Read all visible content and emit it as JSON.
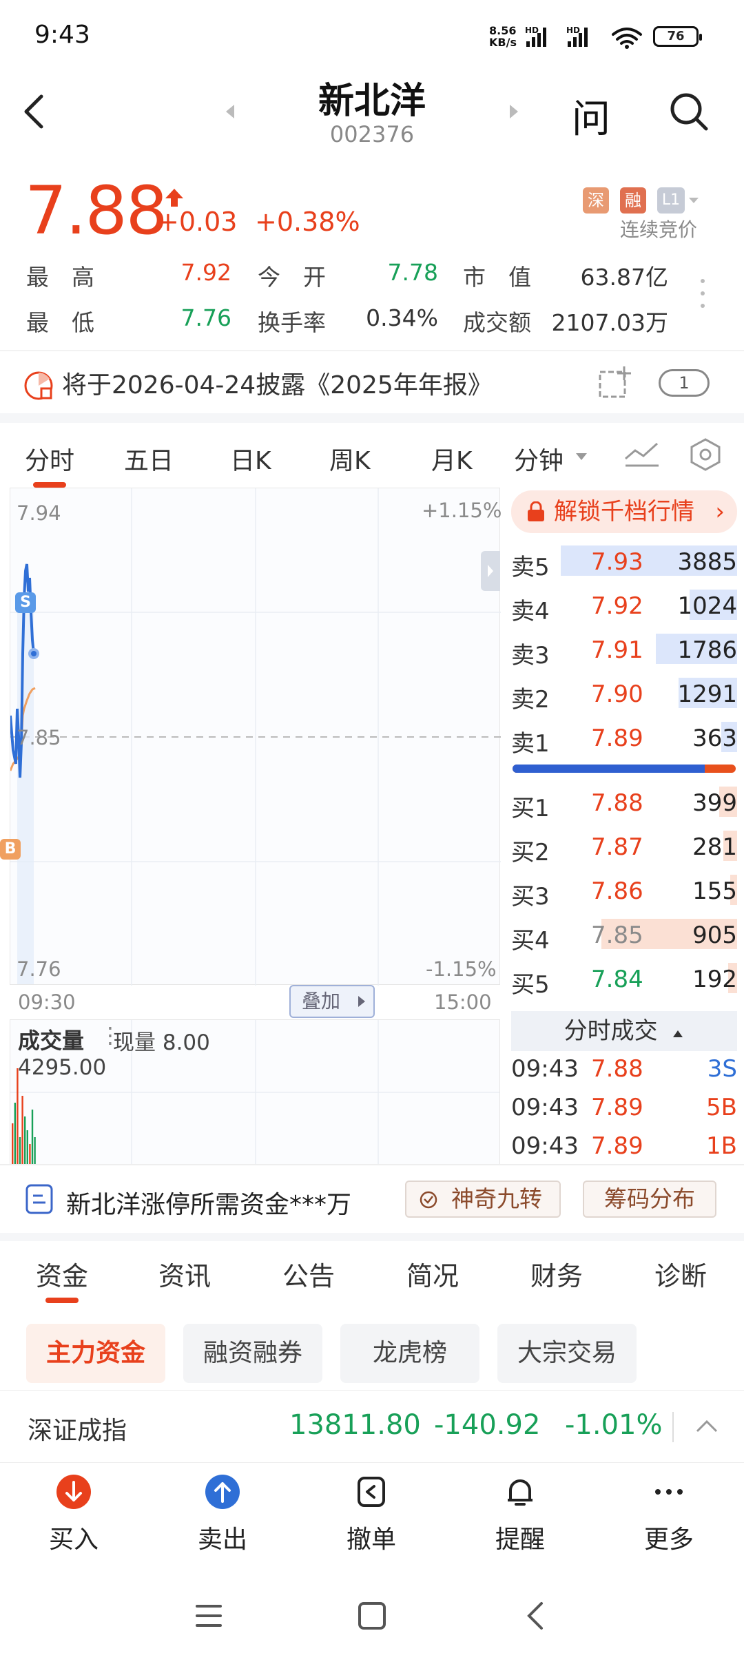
{
  "status_bar": {
    "time": "9:43",
    "net_speed": "8.56",
    "net_unit": "KB/s",
    "battery": "76"
  },
  "header": {
    "title": "新北洋",
    "code": "002376",
    "ask_label": "问"
  },
  "quote": {
    "price": "7.88",
    "change": "+0.03",
    "change_pct": "+0.38%",
    "tags": [
      "深",
      "融",
      "L1"
    ],
    "trade_status": "连续竞价",
    "stats": [
      {
        "label": "最　高",
        "value": "7.92",
        "color": "red"
      },
      {
        "label": "今　开",
        "value": "7.78",
        "color": "green"
      },
      {
        "label": "市　值",
        "value": "63.87亿",
        "color": "dark"
      },
      {
        "label": "最　低",
        "value": "7.76",
        "color": "green"
      },
      {
        "label": "换手率",
        "value": "0.34%",
        "color": "dark"
      },
      {
        "label": "成交额",
        "value": "2107.03万",
        "color": "dark"
      }
    ]
  },
  "notice": {
    "text": "将于2026-04-24披露《2025年年报》",
    "badge": "1"
  },
  "chart_tabs": [
    "分时",
    "五日",
    "日K",
    "周K",
    "月K",
    "分钟"
  ],
  "chart": {
    "y_top": "7.94",
    "y_mid": "7.85",
    "y_bottom": "7.76",
    "pct_top": "+1.15%",
    "pct_bottom": "-1.15%",
    "x_start": "09:30",
    "x_end": "15:00",
    "overlay_label": "叠加",
    "marker_s": "S",
    "marker_b": "B",
    "colors": {
      "price_line": "#2f6fd6",
      "avg_line": "#f0a060",
      "up": "#e8401c",
      "down": "#18a058"
    }
  },
  "volume": {
    "title": "成交量",
    "current_label": "现量 8.00",
    "max_value": "4295.00"
  },
  "order_book": {
    "unlock_label": "解锁千档行情",
    "asks": [
      {
        "label": "卖5",
        "price": "7.93",
        "volume": "3885",
        "color": "red",
        "depth": 0.78
      },
      {
        "label": "卖4",
        "price": "7.92",
        "volume": "1024",
        "color": "red",
        "depth": 0.21
      },
      {
        "label": "卖3",
        "price": "7.91",
        "volume": "1786",
        "color": "red",
        "depth": 0.36
      },
      {
        "label": "卖2",
        "price": "7.90",
        "volume": "1291",
        "color": "red",
        "depth": 0.26
      },
      {
        "label": "卖1",
        "price": "7.89",
        "volume": "363",
        "color": "red",
        "depth": 0.07
      }
    ],
    "bids": [
      {
        "label": "买1",
        "price": "7.88",
        "volume": "399",
        "color": "red",
        "depth": 0.08
      },
      {
        "label": "买2",
        "price": "7.87",
        "volume": "281",
        "color": "red",
        "depth": 0.06
      },
      {
        "label": "买3",
        "price": "7.86",
        "volume": "155",
        "color": "red",
        "depth": 0.03
      },
      {
        "label": "买4",
        "price": "7.85",
        "volume": "905",
        "color": "gray",
        "depth": 0.6
      },
      {
        "label": "买5",
        "price": "7.84",
        "volume": "192",
        "color": "green",
        "depth": 0.04
      }
    ],
    "ask_bid_ratio": 0.86
  },
  "ticks": {
    "header": "分时成交",
    "rows": [
      {
        "time": "09:43",
        "price": "7.88",
        "vol": "3S",
        "vol_color": "blue"
      },
      {
        "time": "09:43",
        "price": "7.89",
        "vol": "5B",
        "vol_color": "red"
      },
      {
        "time": "09:43",
        "price": "7.89",
        "vol": "1B",
        "vol_color": "red"
      }
    ]
  },
  "promo": {
    "text": "新北洋涨停所需资金***万",
    "pill1": "神奇九转",
    "pill2": "筹码分布"
  },
  "info_tabs": [
    "资金",
    "资讯",
    "公告",
    "简况",
    "财务",
    "诊断"
  ],
  "sub_tabs": [
    "主力资金",
    "融资融券",
    "龙虎榜",
    "大宗交易"
  ],
  "index": {
    "name": "深证成指",
    "value": "13811.80",
    "change": "-140.92",
    "change_pct": "-1.01%"
  },
  "bottom_nav": [
    {
      "label": "买入",
      "icon": "buy-arrow-down-icon"
    },
    {
      "label": "卖出",
      "icon": "sell-arrow-up-icon"
    },
    {
      "label": "撤单",
      "icon": "cancel-order-icon"
    },
    {
      "label": "提醒",
      "icon": "bell-icon"
    },
    {
      "label": "更多",
      "icon": "more-dots-icon"
    }
  ]
}
